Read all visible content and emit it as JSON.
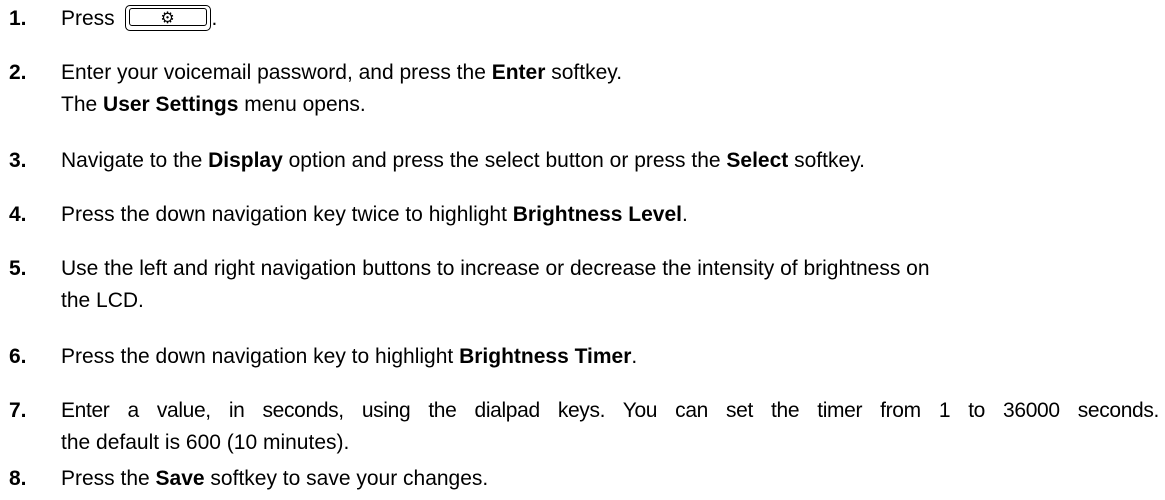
{
  "steps": [
    {
      "number": "1.",
      "parts": {
        "a": "Press",
        "b": "."
      },
      "key_icon": "settings-key-icon",
      "key_glyph": "⚙"
    },
    {
      "number": "2.",
      "lines": [
        {
          "a": "Enter your voicemail password, and press the ",
          "b": "Enter",
          "c": " softkey."
        },
        {
          "a": "The ",
          "b": "User Settings",
          "c": " menu opens."
        }
      ]
    },
    {
      "number": "3.",
      "parts": {
        "a": "Navigate to the ",
        "b": "Display",
        "c": " option and press the select button or press the ",
        "d": "Select",
        "e": " softkey."
      }
    },
    {
      "number": "4.",
      "parts": {
        "a": "Press the down navigation key twice to highlight ",
        "b": "Brightness Level",
        "c": "."
      }
    },
    {
      "number": "5.",
      "lines": [
        "Use the left and right navigation buttons to increase or decrease the intensity of brightness on",
        "the LCD."
      ]
    },
    {
      "number": "6.",
      "parts": {
        "a": "Press the down navigation key to highlight ",
        "b": "Brightness Timer",
        "c": "."
      }
    },
    {
      "number": "7.",
      "lines": [
        "Enter a value, in seconds, using the dialpad keys. You can set the timer from 1 to 36000 seconds.",
        "the default is 600 (10 minutes)."
      ]
    },
    {
      "number": "8.",
      "parts": {
        "a": "Press the ",
        "b": "Save",
        "c": " softkey to save your changes."
      }
    }
  ]
}
